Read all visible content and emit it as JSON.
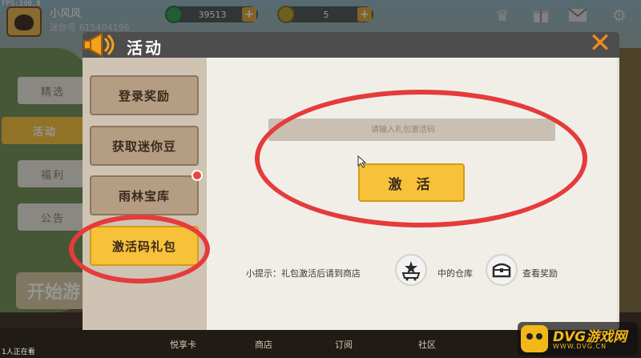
{
  "hud": {
    "fps": "FPS:190.8",
    "player_name": "小风风",
    "player_id": "迷你号 615404196",
    "gems": "39513",
    "coins": "5"
  },
  "game_tabs": [
    {
      "label": "精选",
      "active": false
    },
    {
      "label": "活动",
      "active": true
    },
    {
      "label": "福利",
      "active": false
    },
    {
      "label": "公告",
      "active": false
    }
  ],
  "start_button": "开始游",
  "bottom_bar": {
    "online": "1人正在看",
    "items": [
      "悦享卡",
      "商店",
      "订阅",
      "社区"
    ]
  },
  "panel": {
    "title": "活动",
    "menu": [
      {
        "label": "登录奖励",
        "active": false
      },
      {
        "label": "获取迷你豆",
        "active": false
      },
      {
        "label": "雨林宝库",
        "active": false,
        "badge": true
      },
      {
        "label": "激活码礼包",
        "active": true
      }
    ],
    "code_placeholder": "请输入礼包激活码",
    "activate_label": "激 活",
    "tip_prefix": "小提示：礼包激活后请到商店",
    "tip_mid": "中的仓库",
    "tip_suffix": "查看奖励"
  },
  "watermark": {
    "brand": "DVG游戏网",
    "site": "WWW.DVG.CN"
  },
  "colors": {
    "accent_yellow": "#f7c13a",
    "annotation_red": "#e53b3b",
    "close_orange": "#f08c1e"
  }
}
